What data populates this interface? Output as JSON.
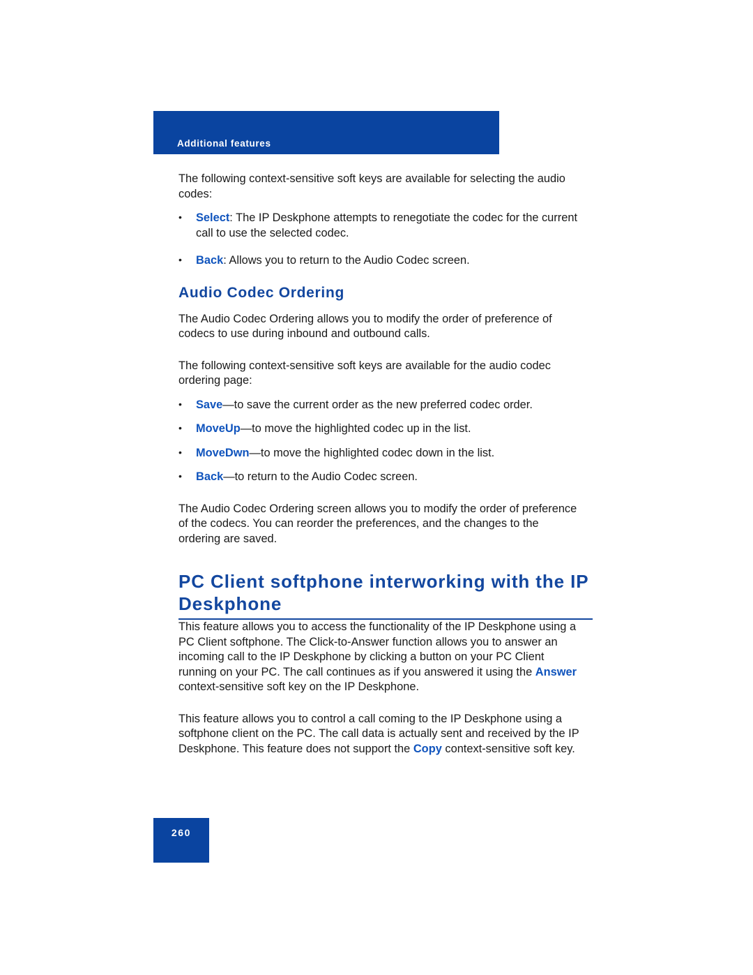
{
  "header": {
    "running_title": "Additional features"
  },
  "content": {
    "intro_paragraph": "The following context-sensitive soft keys are available for selecting the audio codes:",
    "select_softkeys": [
      {
        "key": "Select",
        "separator": ": ",
        "description": "The IP Deskphone attempts to renegotiate the codec for the current call to use the selected codec."
      },
      {
        "key": "Back",
        "separator": ": ",
        "description": "Allows you to return to the Audio Codec screen."
      }
    ],
    "sub_heading": "Audio Codec Ordering",
    "ordering_intro": "The Audio Codec Ordering allows you to modify the order of preference of codecs to use during inbound and outbound calls.",
    "ordering_softkeys_intro": "The following context-sensitive soft keys are available for the audio codec ordering page:",
    "ordering_softkeys": [
      {
        "key": "Save",
        "separator": "—",
        "description": "to save the current order as the new preferred codec order."
      },
      {
        "key": "MoveUp",
        "separator": "—",
        "description": "to move the highlighted codec up in the list."
      },
      {
        "key": "MoveDwn",
        "separator": "—",
        "description": "to move the highlighted codec down in the list."
      },
      {
        "key": "Back",
        "separator": "—",
        "description": "to return to the Audio Codec screen."
      }
    ],
    "ordering_summary": "The Audio Codec Ordering screen allows you to modify the order of preference of the codecs. You can reorder the preferences, and the changes to the ordering are saved.",
    "section_heading": "PC Client softphone interworking with the IP Deskphone",
    "pc_client_paragraph_1": {
      "before": "This feature allows you to access the functionality of the IP Deskphone using a PC Client softphone. The Click-to-Answer function allows you to answer an incoming call to the IP Deskphone by clicking a button on your PC Client running on your PC. The call continues as if you answered it using the ",
      "softkey": "Answer",
      "after": " context-sensitive soft key on the IP Deskphone."
    },
    "pc_client_paragraph_2": {
      "before": "This feature allows you to control a call coming to the IP Deskphone using a softphone client on the PC. The call data is actually sent and received by the IP Deskphone. This feature does not support the ",
      "softkey": "Copy",
      "after": " context-sensitive soft key."
    }
  },
  "footer": {
    "page_number": "260"
  },
  "colors": {
    "brand_blue": "#0a44a0",
    "heading_blue": "#13479f",
    "softkey_blue": "#1054bd",
    "body_text": "#1a1a1a",
    "page_background": "#ffffff"
  }
}
